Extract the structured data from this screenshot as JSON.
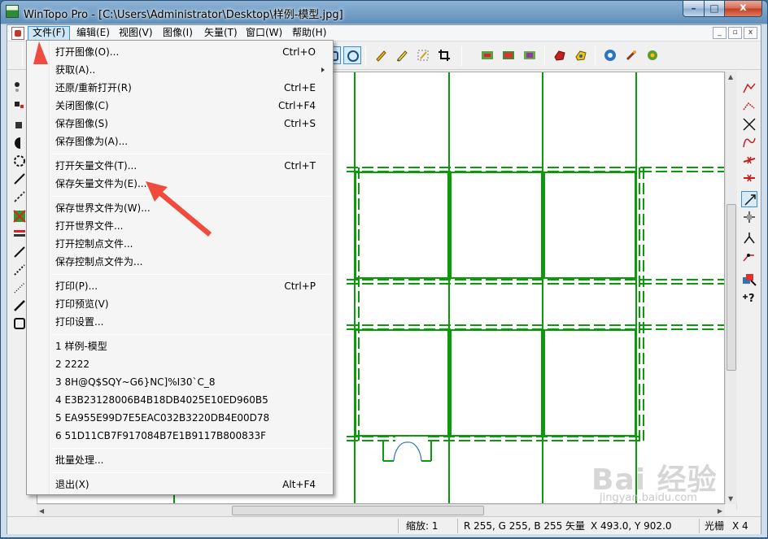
{
  "window": {
    "title": "WinTopo Pro - [C:\\Users\\Administrator\\Desktop\\样例-模型.jpg]",
    "accent": "#3c8fd0"
  },
  "window_controls": {
    "min": "–",
    "max": "□",
    "close": "x"
  },
  "menubar": {
    "items": [
      {
        "label": "文件(F)"
      },
      {
        "label": "编辑(E)"
      },
      {
        "label": "视图(V)"
      },
      {
        "label": "图像(I)"
      },
      {
        "label": "矢量(T)"
      },
      {
        "label": "窗口(W)"
      },
      {
        "label": "帮助(H)"
      }
    ],
    "active_item": "文件(F)",
    "mdi_controls": [
      "_",
      "▫",
      "x"
    ]
  },
  "file_menu": {
    "items": [
      {
        "label": "打开图像(O)...",
        "shortcut": "Ctrl+O"
      },
      {
        "label": "获取(A)..",
        "shortcut": "",
        "submenu": true
      },
      {
        "label": "还原/重新打开(R)",
        "shortcut": "Ctrl+E"
      },
      {
        "label": "关闭图像(C)",
        "shortcut": "Ctrl+F4"
      },
      {
        "label": "保存图像(S)",
        "shortcut": "Ctrl+S"
      },
      {
        "label": "保存图像为(A)...",
        "shortcut": ""
      },
      {
        "label": "打开矢量文件(T)...",
        "shortcut": "Ctrl+T"
      },
      {
        "label": "保存矢量文件为(E)...",
        "shortcut": ""
      },
      {
        "label": "保存世界文件为(W)...",
        "shortcut": ""
      },
      {
        "label": "打开世界文件...",
        "shortcut": ""
      },
      {
        "label": "打开控制点文件...",
        "shortcut": ""
      },
      {
        "label": "保存控制点文件为...",
        "shortcut": ""
      },
      {
        "label": "打印(P)...",
        "shortcut": "Ctrl+P"
      },
      {
        "label": "打印预览(V)",
        "shortcut": ""
      },
      {
        "label": "打印设置...",
        "shortcut": ""
      },
      {
        "label": "1 样例-模型",
        "shortcut": ""
      },
      {
        "label": "2 2222",
        "shortcut": ""
      },
      {
        "label": "3 8H@Q$SQY~G6}NC]%I30`C_8",
        "shortcut": ""
      },
      {
        "label": "4 E3B23128006B4B18DB4025E10ED960B5",
        "shortcut": ""
      },
      {
        "label": "5 EA955E99D7E5EAC032B3220DB4E00D78",
        "shortcut": ""
      },
      {
        "label": "6 51D11CB7F917084B7E1B9117B800833F",
        "shortcut": ""
      },
      {
        "label": "批量处理...",
        "shortcut": ""
      },
      {
        "label": "退出(X)",
        "shortcut": "Alt+F4"
      }
    ]
  },
  "statusbar": {
    "zoom": "缩放: 1",
    "rgb": "R 255, G 255, B 255",
    "vector_label": "矢量",
    "coords": "X 493.0, Y 902.0",
    "raster_label": "光栅",
    "raster_x": "X 4"
  },
  "watermark": {
    "text": "Bai 经验",
    "url": "jingyan.baidu.com"
  },
  "colors": {
    "drawing_line": "#0a9a0a",
    "annotation_arrow": "#ef4b3f"
  }
}
